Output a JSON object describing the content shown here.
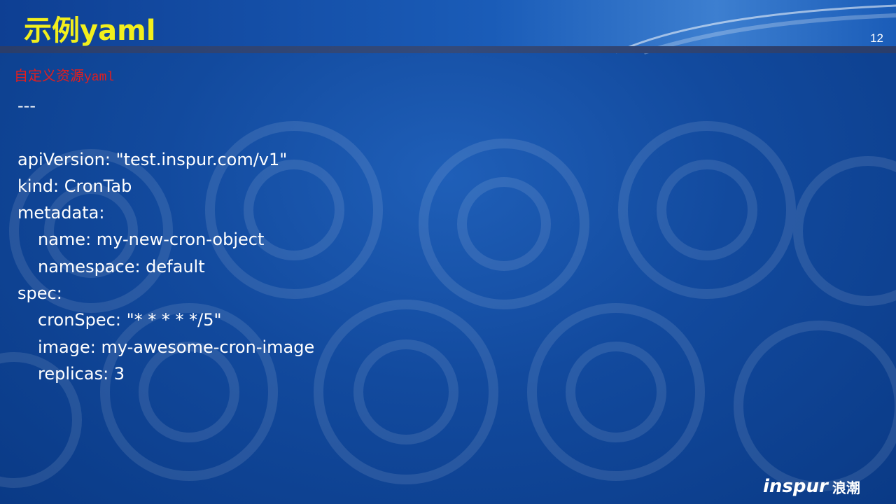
{
  "slide": {
    "title": "示例yaml",
    "page_number": "12",
    "subtitle_cn": "自定义资源",
    "subtitle_en": "yaml"
  },
  "code_lines": [
    {
      "text": "---",
      "indent": false
    },
    {
      "text": "",
      "indent": false
    },
    {
      "text": "apiVersion: \"test.inspur.com/v1\"",
      "indent": false
    },
    {
      "text": "kind: CronTab",
      "indent": false
    },
    {
      "text": "metadata:",
      "indent": false
    },
    {
      "text": "name: my-new-cron-object",
      "indent": true
    },
    {
      "text": "namespace: default",
      "indent": true
    },
    {
      "text": "spec:",
      "indent": false
    },
    {
      "text": "cronSpec: \"* * * * */5\"",
      "indent": true
    },
    {
      "text": "image: my-awesome-cron-image",
      "indent": true
    },
    {
      "text": "replicas: 3",
      "indent": true
    }
  ],
  "logo": {
    "brand": "inspur",
    "brand_cn": "浪潮"
  },
  "colors": {
    "title": "#f2ef1c",
    "subtitle": "#e21d1d",
    "code_text": "#ffffff",
    "background": "#124a9e"
  }
}
